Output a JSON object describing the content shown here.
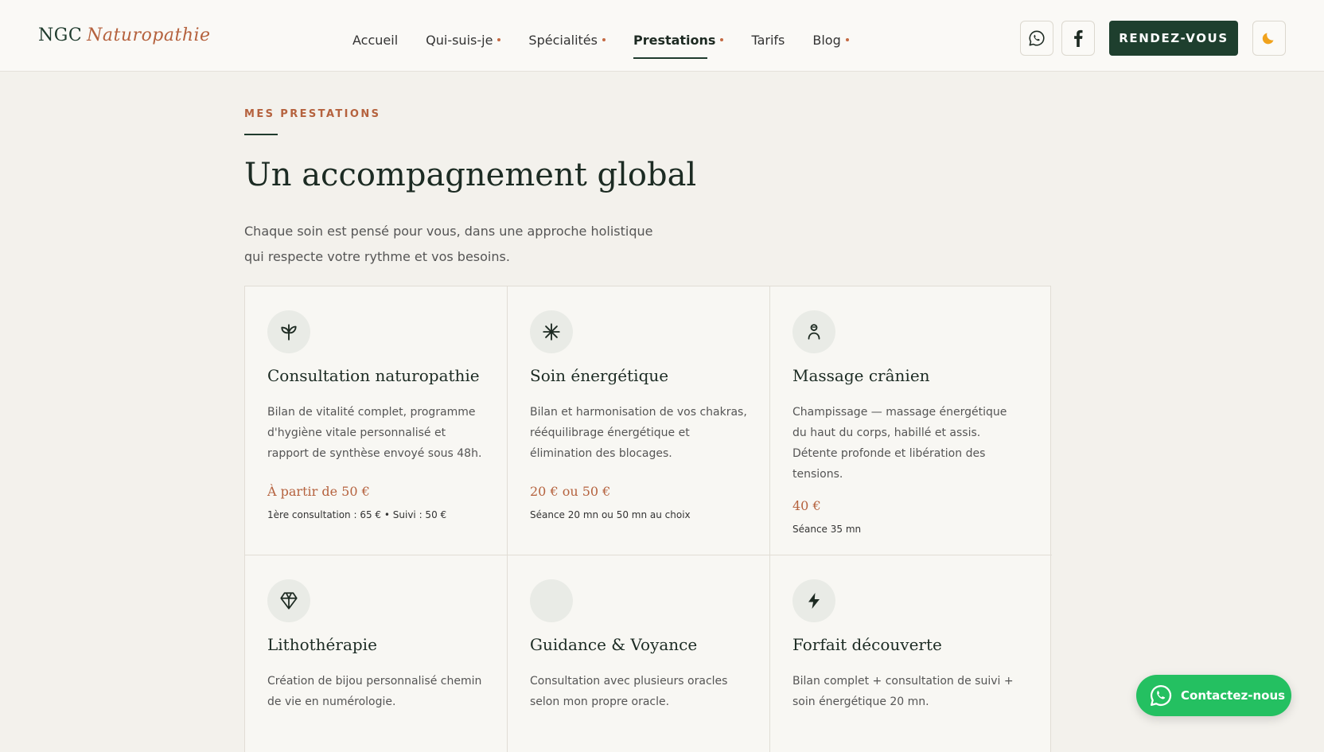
{
  "header": {
    "logo_main": "NGC",
    "logo_accent": "Naturopathie",
    "nav": [
      {
        "label": "Accueil"
      },
      {
        "label": "Qui-suis-je"
      },
      {
        "label": "Spécialités"
      },
      {
        "label": "Prestations"
      },
      {
        "label": "Tarifs"
      },
      {
        "label": "Blog"
      }
    ],
    "rdv_label": "RENDEZ-VOUS",
    "icons": [
      "whatsapp-icon",
      "facebook-icon",
      "moon-icon"
    ]
  },
  "section": {
    "eyebrow": "MES PRESTATIONS",
    "title": "Un accompagnement global",
    "lead": "Chaque soin est pensé pour vous, dans une approche holistique qui respecte votre rythme et vos besoins."
  },
  "cards": [
    {
      "icon": "leaf-icon",
      "title": "Consultation naturopathie",
      "desc": "Bilan de vitalité complet, programme d'hygiène vitale personnalisé et rapport de synthèse envoyé sous 48h.",
      "price": "À partir de 50 €",
      "sub": "1ère consultation : 65 € • Suivi : 50 €"
    },
    {
      "icon": "sparkle-icon",
      "title": "Soin énergétique",
      "desc": "Bilan et harmonisation de vos chakras, rééquilibrage énergétique et élimination des blocages.",
      "price": "20 € ou 50 €",
      "sub": "Séance 20 mn ou 50 mn au choix"
    },
    {
      "icon": "person-icon",
      "title": "Massage crânien",
      "desc": "Champissage — massage énergétique du haut du corps, habillé et assis. Détente profonde et libération des tensions.",
      "price": "40 €",
      "sub": "Séance 35 mn"
    },
    {
      "icon": "gem-icon",
      "title": "Lithothérapie",
      "desc": "Création de bijou personnalisé chemin de vie en numérologie."
    },
    {
      "icon": "moon-crescent-icon",
      "title": "Guidance & Voyance",
      "desc": "Consultation avec plusieurs oracles selon mon propre oracle."
    },
    {
      "icon": "bolt-icon",
      "title": "Forfait découverte",
      "desc": "Bilan complet + consultation de suivi + soin énergétique 20 mn."
    }
  ],
  "floating": {
    "label": "Contactez-nous",
    "icon": "whatsapp-icon"
  },
  "colors": {
    "brand_green": "#1e3f2e",
    "accent_terracotta": "#b5623e",
    "whatsapp_green": "#24c061",
    "background": "#f3f1ec"
  }
}
